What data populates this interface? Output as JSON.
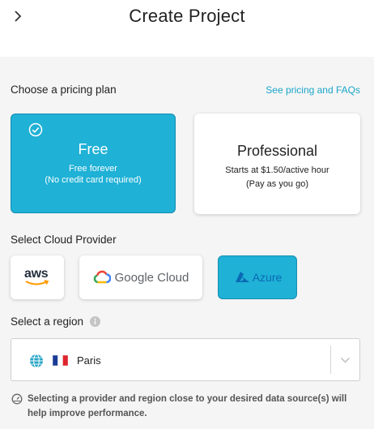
{
  "header": {
    "title": "Create Project"
  },
  "pricing": {
    "label": "Choose a pricing plan",
    "link": "See pricing and FAQs",
    "plans": [
      {
        "name": "Free",
        "line1": "Free forever",
        "line2": "(No credit card required)",
        "selected": true
      },
      {
        "name": "Professional",
        "line1": "Starts at $1.50/active hour",
        "line2": "(Pay as you go)",
        "selected": false
      }
    ]
  },
  "provider": {
    "label": "Select Cloud Provider",
    "options": [
      {
        "name": "aws",
        "icon": "aws-logo-icon",
        "selected": false
      },
      {
        "name": "Google Cloud",
        "icon": "google-cloud-logo-icon",
        "selected": false
      },
      {
        "name": "Azure",
        "icon": "azure-logo-icon",
        "selected": true
      }
    ]
  },
  "region": {
    "label": "Select a region",
    "value": "Paris",
    "icons": [
      "info-icon",
      "globe-icon",
      "france-flag-icon",
      "chevron-down-icon"
    ]
  },
  "note": {
    "text": "Selecting a provider and region close to your desired data source(s) will help improve performance."
  },
  "colors": {
    "accent": "#1fb1d6",
    "link": "#1aa5c9",
    "background": "#f5f5f5"
  }
}
